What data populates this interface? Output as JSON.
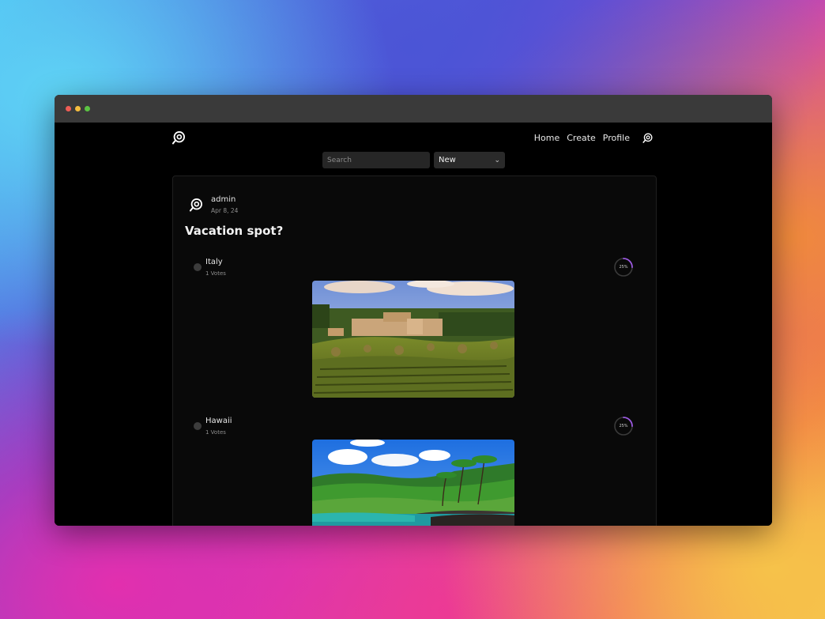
{
  "nav": {
    "links": [
      "Home",
      "Create",
      "Profile"
    ]
  },
  "filters": {
    "search_placeholder": "Search",
    "sort_value": "New"
  },
  "post": {
    "author": "admin",
    "date": "Apr 8, 24",
    "title": "Vacation spot?",
    "options": [
      {
        "label": "Italy",
        "votes": "1 Votes",
        "percent_label": "25%",
        "percent": 0.25,
        "image": "tuscany-vineyard-photo"
      },
      {
        "label": "Hawaii",
        "votes": "1 Votes",
        "percent_label": "25%",
        "percent": 0.25,
        "image": "hawaii-coast-photo"
      }
    ]
  },
  "colors": {
    "ring_accent": "#9b59e0",
    "ring_track": "#3a3a3a"
  },
  "icons": [
    "app-logo-icon",
    "profile-avatar-icon",
    "chevron-down-icon"
  ]
}
